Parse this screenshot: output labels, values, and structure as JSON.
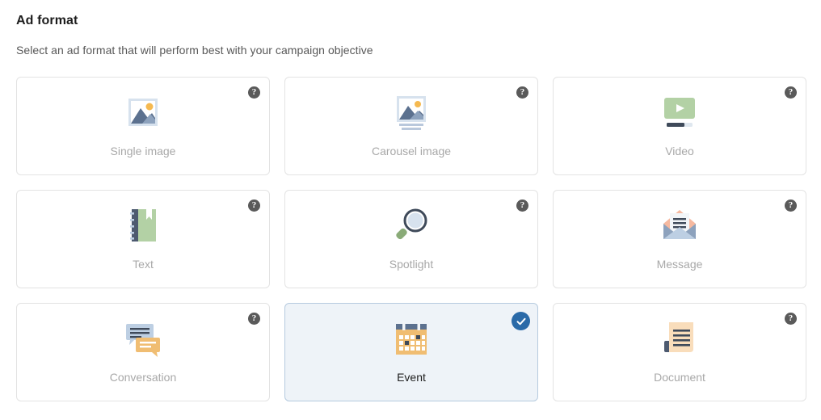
{
  "header": {
    "title": "Ad format",
    "subtitle": "Select an ad format that will perform best with your campaign objective"
  },
  "colors": {
    "accent": "#2a6aa8",
    "selected_card_bg": "#eef3f8",
    "selected_card_border": "#b6cbdf",
    "card_border": "#e3e3e3",
    "label_muted": "#a8a8a8",
    "label_selected": "#1d1d1d",
    "icon_slate": "#5c718f",
    "icon_navy": "#3f4a5a",
    "icon_green": "#b3d1a5",
    "icon_amber": "#f0bd72",
    "icon_lightblue": "#bdcfe3",
    "icon_peach": "#f9ddbb",
    "icon_salmon": "#f6b9a0",
    "help_badge_bg": "#5a5a5a"
  },
  "help_icon_label": "?",
  "cards": [
    {
      "label": "Single image",
      "icon": "single-image-icon",
      "selected": false,
      "badge": "help-icon"
    },
    {
      "label": "Carousel image",
      "icon": "carousel-image-icon",
      "selected": false,
      "badge": "help-icon"
    },
    {
      "label": "Video",
      "icon": "video-icon",
      "selected": false,
      "badge": "help-icon"
    },
    {
      "label": "Text",
      "icon": "text-icon",
      "selected": false,
      "badge": "help-icon"
    },
    {
      "label": "Spotlight",
      "icon": "spotlight-icon",
      "selected": false,
      "badge": "help-icon"
    },
    {
      "label": "Message",
      "icon": "message-icon",
      "selected": false,
      "badge": "help-icon"
    },
    {
      "label": "Conversation",
      "icon": "conversation-icon",
      "selected": false,
      "badge": "help-icon"
    },
    {
      "label": "Event",
      "icon": "event-icon",
      "selected": true,
      "badge": "check-icon"
    },
    {
      "label": "Document",
      "icon": "document-icon",
      "selected": false,
      "badge": "help-icon"
    }
  ]
}
